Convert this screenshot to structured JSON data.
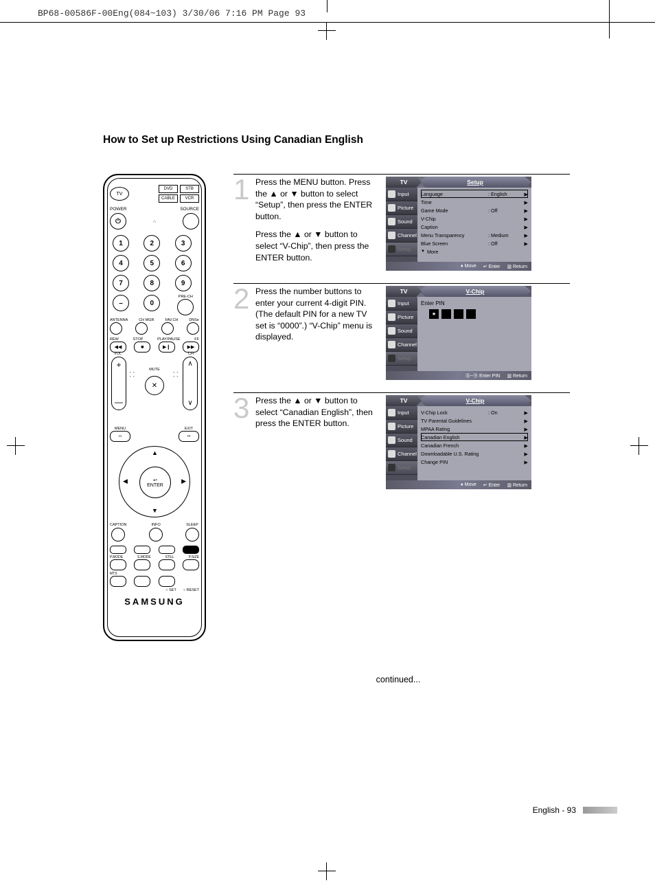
{
  "print_header": "BP68-00586F-00Eng(084~103)  3/30/06  7:16 PM  Page 93",
  "title": "How to Set up Restrictions Using Canadian English",
  "remote": {
    "tv": "TV",
    "chips": [
      "DVD",
      "STB",
      "CABLE",
      "VCR"
    ],
    "power": "POWER",
    "source": "SOURCE",
    "numbers": [
      "1",
      "2",
      "3",
      "4",
      "5",
      "6",
      "7",
      "8",
      "9"
    ],
    "dash": "–",
    "zero": "0",
    "prech": "PRE-CH",
    "mini_labels": [
      "ANTENNA",
      "CH MGR",
      "FAV.CH",
      "DNSe"
    ],
    "vcr_labels": [
      "REW",
      "STOP",
      "PLAY/PAUSE",
      "FF"
    ],
    "vcr_icons": [
      "◀◀",
      "■",
      "▶❙",
      "▶▶"
    ],
    "vol": "VOL",
    "ch": "CH",
    "mute": "MUTE",
    "menu": "MENU",
    "exit": "EXIT",
    "enter": "ENTER",
    "below": [
      "CAPTION",
      "INFO",
      "SLEEP"
    ],
    "mode2": [
      "P.MODE",
      "S.MODE",
      "STILL",
      "P.SIZE"
    ],
    "mts": "MTS",
    "setreset": [
      "○ SET",
      "○ RESET"
    ],
    "brand": "SAMSUNG"
  },
  "steps": [
    {
      "num": "1",
      "paragraphs": [
        "Press the MENU button. Press the ▲ or ▼ button to select “Setup”, then press the ENTER button.",
        "Press the ▲ or ▼ button to select “V-Chip”, then press the ENTER button."
      ],
      "osd": {
        "tab_left": "TV",
        "tab_right": "Setup",
        "sidebar": [
          "Input",
          "Picture",
          "Sound",
          "Channel",
          "Setup"
        ],
        "rows": [
          {
            "label": "Language",
            "value": ": English",
            "boxed": true
          },
          {
            "label": "Time",
            "value": ""
          },
          {
            "label": "Game Mode",
            "value": ": Off"
          },
          {
            "label": "V-Chip",
            "value": ""
          },
          {
            "label": "Caption",
            "value": ""
          },
          {
            "label": "Menu Transparency",
            "value": ": Medium"
          },
          {
            "label": "Blue Screen",
            "value": ": Off"
          }
        ],
        "more": "More",
        "footer": [
          "Move",
          "Enter",
          "Return"
        ],
        "footer_syms": [
          "♦",
          "↵",
          "▥"
        ]
      }
    },
    {
      "num": "2",
      "paragraphs": [
        "Press the number buttons to enter your current 4-digit PIN. (The default PIN for a new TV set is “0000”.) “V-Chip” menu is displayed."
      ],
      "osd": {
        "tab_left": "TV",
        "tab_right": "V-Chip",
        "sidebar": [
          "Input",
          "Picture",
          "Sound",
          "Channel",
          "Setup"
        ],
        "enter_pin": "Enter PIN",
        "footer": [
          "Enter PIN",
          "Return"
        ],
        "footer_syms": [
          "⓪~⑨",
          "▥"
        ]
      }
    },
    {
      "num": "3",
      "paragraphs": [
        "Press the ▲ or ▼ button to select “Canadian English”, then press the ENTER button."
      ],
      "osd": {
        "tab_left": "TV",
        "tab_right": "V-Chip",
        "sidebar": [
          "Input",
          "Picture",
          "Sound",
          "Channel",
          "Setup"
        ],
        "rows": [
          {
            "label": "V-Chip Lock",
            "value": ": On"
          },
          {
            "label": "TV Parental Guidelines",
            "value": ""
          },
          {
            "label": "MPAA Rating",
            "value": ""
          },
          {
            "label": "Canadian English",
            "value": "",
            "boxed": true
          },
          {
            "label": "Canadian French",
            "value": ""
          },
          {
            "label": "Downloadable U.S. Rating",
            "value": ""
          },
          {
            "label": "Change PIN",
            "value": ""
          }
        ],
        "footer": [
          "Move",
          "Enter",
          "Return"
        ],
        "footer_syms": [
          "♦",
          "↵",
          "▥"
        ]
      }
    }
  ],
  "continued": "continued...",
  "page_footer": "English - 93"
}
